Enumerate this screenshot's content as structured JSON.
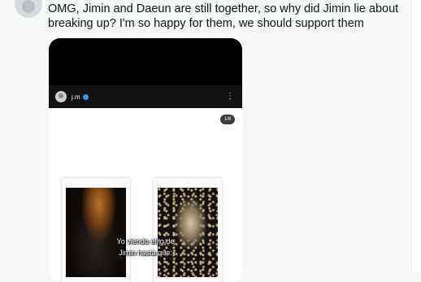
{
  "tweet": {
    "text": "OMG, Jimin and Daeun are still together, so why did Jimin lie about breaking up? I'm so happy for them, we should support them"
  },
  "embedded_post": {
    "username": "j.m",
    "verified": true,
    "slide_counter": "1/6",
    "caption_line1": "Yo viendo el ig de",
    "caption_line2": "Jimin hasta que:"
  },
  "icons": {
    "avatar": "avatar",
    "verified": "verified-badge-icon",
    "more": "more-options-icon"
  },
  "colors": {
    "page_background": "#f7f9f9",
    "text": "#0f1419",
    "verified_blue": "#3897f0"
  }
}
